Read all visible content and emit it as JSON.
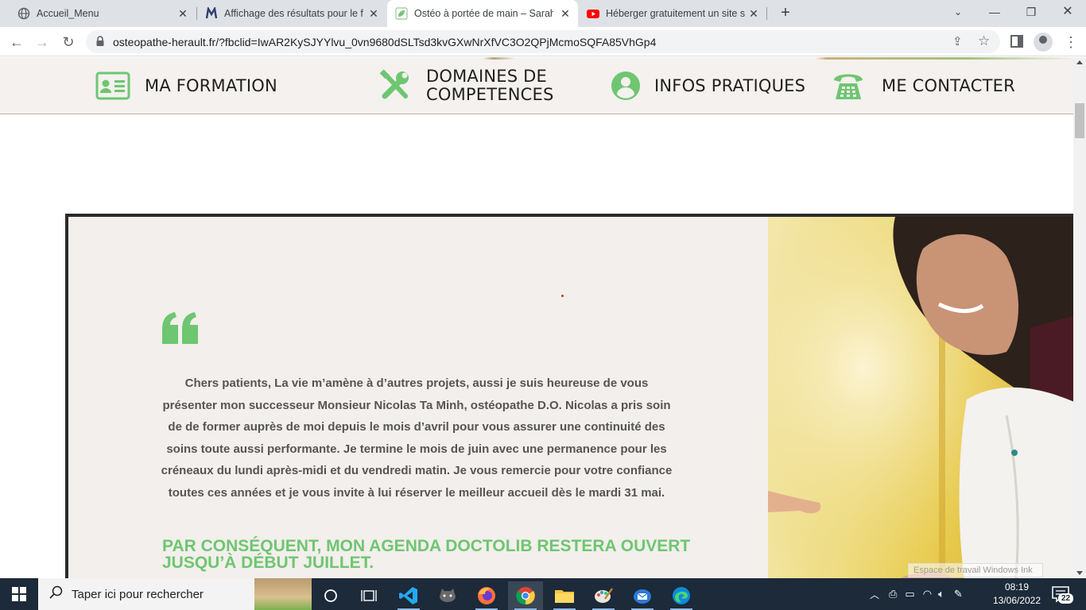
{
  "browser": {
    "tabs": [
      {
        "title": "Accueil_Menu",
        "favicon": "globe-icon",
        "active": false
      },
      {
        "title": "Affichage des résultats pour le fic",
        "favicon": "site-logo-icon",
        "active": false
      },
      {
        "title": "Ostéo à portée de main – Sarah M",
        "favicon": "leaf-icon",
        "active": true
      },
      {
        "title": "Héberger gratuitement un site su",
        "favicon": "youtube-icon",
        "active": false
      }
    ],
    "url": "osteopathe-herault.fr/?fbclid=IwAR2KySJYYlvu_0vn9680dSLTsd3kvGXwNrXfVC3O2QPjMcmoSQFA85VhGp4"
  },
  "site_nav": {
    "items": [
      {
        "label": "MA FORMATION",
        "icon": "id-card-icon"
      },
      {
        "label": "DOMAINES DE COMPETENCES",
        "line1": "DOMAINES DE",
        "line2": "COMPETENCES",
        "icon": "tools-icon"
      },
      {
        "label": "INFOS PRATIQUES",
        "icon": "user-circle-icon"
      },
      {
        "label": "ME CONTACTER",
        "icon": "telephone-icon"
      }
    ]
  },
  "main": {
    "quote": "Chers patients, La vie m’amène à d’autres projets, aussi je suis heureuse de vous présenter mon successeur Monsieur Nicolas Ta Minh, ostéopathe D.O. Nicolas a pris soin de de former auprès de moi depuis le mois d’avril pour vous assurer une continuité des soins toute aussi performante. Je termine le mois de juin avec une permanence pour les créneaux du lundi après-midi et du vendredi matin. Je vous remercie pour votre confiance toutes ces années et je vous invite à lui réserver le meilleur accueil dès le mardi 31 mai.",
    "headline": "PAR CONSÉQUENT, MON AGENDA DOCTOLIB RESTERA OUVERT JUSQU’À DÉBUT JUILLET.",
    "accent_color": "#6ec671"
  },
  "overlay": {
    "watermark": "Espace de travail Windows Ink"
  },
  "taskbar": {
    "search_placeholder": "Taper ici pour rechercher",
    "time": "08:19",
    "date": "13/06/2022",
    "notification_count": "22"
  }
}
